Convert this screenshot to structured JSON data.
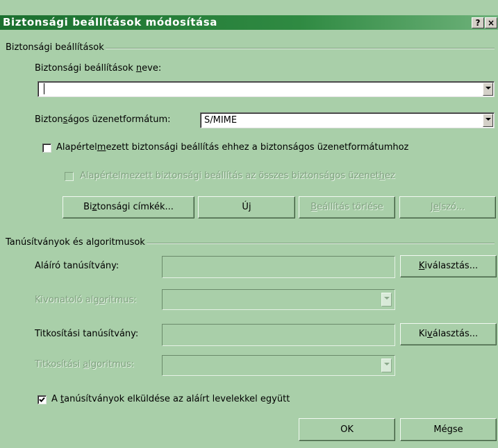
{
  "title": "Biztonsági beállítások módosítása",
  "titlebar": {
    "help": "?",
    "close": "×"
  },
  "group1": {
    "label": "Biztonsági beállítások",
    "name_label_pre": "Biztonsági beállítások ",
    "name_label_key": "n",
    "name_label_post": "eve:",
    "name_value": "",
    "format_label_pre": "Bizton",
    "format_label_key": "s",
    "format_label_post": "ágos üzenetformátum:",
    "format_value": "S/MIME",
    "cb1_pre": "Alapértel",
    "cb1_key": "m",
    "cb1_post": "ezett biztonsági beállítás ehhez a biztonságos üzenetformátumhoz",
    "cb1_checked": false,
    "cb2_pre": "Alapértelmezett biztonsági beállítás az összes biztonságos üzenet",
    "cb2_key": "h",
    "cb2_post": "ez",
    "cb2_checked": false,
    "btn_labels_pre": "Bi",
    "btn_labels_key": "z",
    "btn_labels_post": "tonsági címkék...",
    "btn_new_pre": "Ú",
    "btn_new_key": "j",
    "btn_new_post": "",
    "btn_delete_pre": "",
    "btn_delete_key": "B",
    "btn_delete_post": "eállítás törlése",
    "btn_password_pre": "J",
    "btn_password_key": "e",
    "btn_password_post": "lszó..."
  },
  "group2": {
    "label": "Tanúsítványok és algoritmusok",
    "sign_cert_label": "Aláíró tanúsítvány:",
    "sign_cert_value": "",
    "choose1_pre": "",
    "choose1_key": "K",
    "choose1_post": "iválasztás...",
    "hash_label_pre": "Kivonatoló alg",
    "hash_label_key": "o",
    "hash_label_post": "ritmus:",
    "enc_cert_label": "Titkosítási tanúsítvány:",
    "enc_cert_value": "",
    "choose2_pre": "Ki",
    "choose2_key": "v",
    "choose2_post": "álasztás...",
    "enc_alg_pre": "Titkosítási ",
    "enc_alg_key": "a",
    "enc_alg_post": "lgoritmus:",
    "send_pre": "A ",
    "send_key": "t",
    "send_post": "anúsítványok elküldése az aláírt levelekkel együtt",
    "send_checked": true
  },
  "buttons": {
    "ok": "OK",
    "cancel": "Mégse"
  }
}
